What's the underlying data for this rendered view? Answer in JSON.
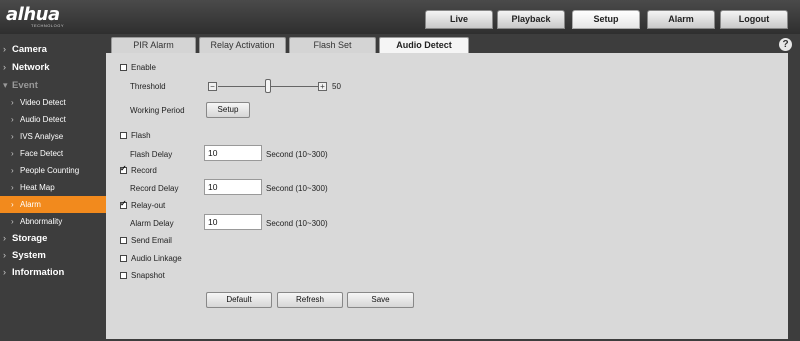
{
  "brand": {
    "logo": "alhua",
    "sub": "TECHNOLOGY"
  },
  "top_nav": [
    {
      "label": "Live"
    },
    {
      "label": "Playback"
    },
    {
      "label": "Setup",
      "active": true
    },
    {
      "label": "Alarm"
    },
    {
      "label": "Logout"
    }
  ],
  "sidebar": {
    "items": [
      {
        "label": "Camera",
        "level": "main"
      },
      {
        "label": "Network",
        "level": "main"
      },
      {
        "label": "Event",
        "level": "main",
        "expanded": true
      },
      {
        "label": "Video Detect",
        "level": "sub"
      },
      {
        "label": "Audio Detect",
        "level": "sub"
      },
      {
        "label": "IVS Analyse",
        "level": "sub"
      },
      {
        "label": "Face Detect",
        "level": "sub"
      },
      {
        "label": "People Counting",
        "level": "sub"
      },
      {
        "label": "Heat Map",
        "level": "sub"
      },
      {
        "label": "Alarm",
        "level": "sub",
        "active": true
      },
      {
        "label": "Abnormality",
        "level": "sub"
      },
      {
        "label": "Storage",
        "level": "main"
      },
      {
        "label": "System",
        "level": "main"
      },
      {
        "label": "Information",
        "level": "main"
      }
    ]
  },
  "help_icon": "question-mark",
  "sub_tabs": [
    {
      "label": "PIR Alarm"
    },
    {
      "label": "Relay Activation"
    },
    {
      "label": "Flash Set"
    },
    {
      "label": "Audio Detect",
      "active": true
    }
  ],
  "form": {
    "enable": {
      "label": "Enable",
      "checked": false
    },
    "threshold": {
      "label": "Threshold",
      "value": 50,
      "min_symbol": "−",
      "max_symbol": "+",
      "value_text": "50"
    },
    "working_period": {
      "label": "Working Period",
      "button": "Setup"
    },
    "flash": {
      "label": "Flash",
      "checked": false
    },
    "flash_delay": {
      "label": "Flash Delay",
      "value": "10",
      "unit": "Second (10~300)"
    },
    "record": {
      "label": "Record",
      "checked": true
    },
    "record_delay": {
      "label": "Record Delay",
      "value": "10",
      "unit": "Second (10~300)"
    },
    "relay_out": {
      "label": "Relay-out",
      "checked": true
    },
    "alarm_delay": {
      "label": "Alarm Delay",
      "value": "10",
      "unit": "Second (10~300)"
    },
    "send_email": {
      "label": "Send Email",
      "checked": false
    },
    "audio_linkage": {
      "label": "Audio Linkage",
      "checked": false
    },
    "snapshot": {
      "label": "Snapshot",
      "checked": false
    }
  },
  "buttons": {
    "default": "Default",
    "refresh": "Refresh",
    "save": "Save"
  },
  "colors": {
    "accent": "#f28a1d",
    "background": "#3d3d3d",
    "panel": "#d9d9d9"
  }
}
